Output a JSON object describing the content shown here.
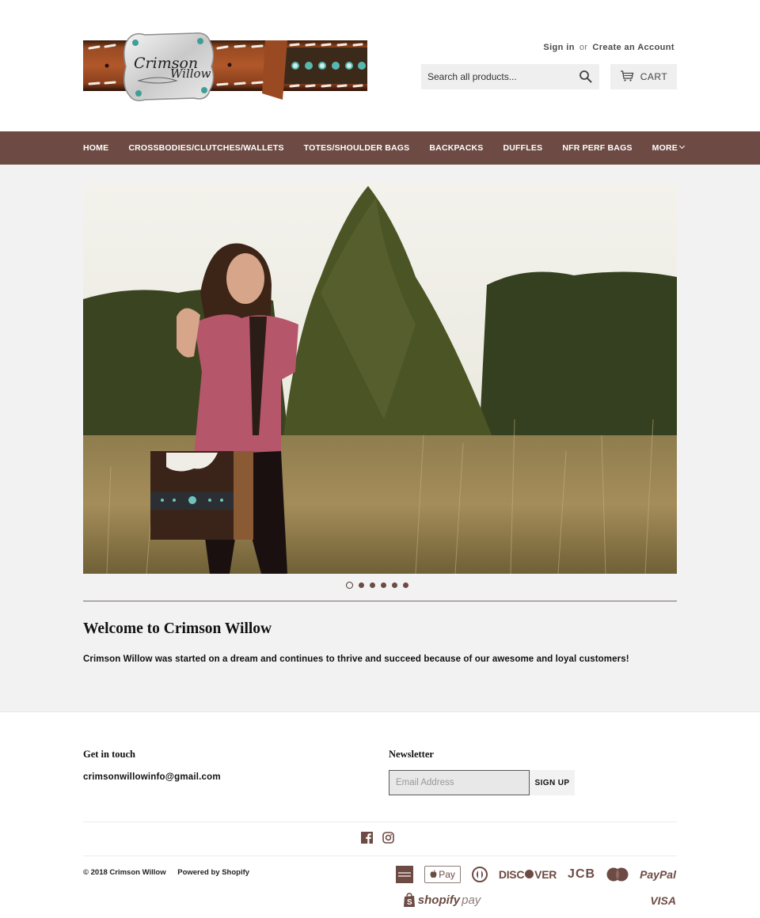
{
  "brand": {
    "name": "Crimson Willow",
    "logo_text_1": "Crimson",
    "logo_text_2": "Willow",
    "accent_color": "#6d4b44"
  },
  "header": {
    "sign_in": "Sign in",
    "or": "or",
    "create_account": "Create an Account",
    "search_placeholder": "Search all products...",
    "cart_label": "CART"
  },
  "nav": {
    "items": [
      {
        "label": "HOME"
      },
      {
        "label": "CROSSBODIES/CLUTCHES/WALLETS"
      },
      {
        "label": "TOTES/SHOULDER BAGS"
      },
      {
        "label": "BACKPACKS"
      },
      {
        "label": "DUFFLES"
      },
      {
        "label": "NFR PERF BAGS"
      },
      {
        "label": "MORE"
      }
    ]
  },
  "hero": {
    "slide_count": 6,
    "active_slide": 1,
    "image_alt": "Woman in a pink shirt carrying a cowhide tote bag in a grassy field"
  },
  "welcome": {
    "title": "Welcome to Crimson Willow",
    "text": "Crimson Willow was started on a dream and continues to thrive and succeed because of our awesome and loyal customers!"
  },
  "footer": {
    "contact_title": "Get in touch",
    "contact_email": "crimsonwillowinfo@gmail.com",
    "newsletter_title": "Newsletter",
    "newsletter_placeholder": "Email Address",
    "signup_label": "SIGN UP",
    "social": [
      "facebook-icon",
      "instagram-icon"
    ],
    "copyright": "© 2018 Crimson Willow",
    "powered_by": "Powered by Shopify",
    "payments": [
      {
        "name": "american-express",
        "label": "AMEX"
      },
      {
        "name": "apple-pay",
        "label": "Pay"
      },
      {
        "name": "diners-club",
        "label": ""
      },
      {
        "name": "discover",
        "label": "DISC",
        "label2": "VER"
      },
      {
        "name": "jcb",
        "label": "JCB"
      },
      {
        "name": "mastercard",
        "label": "MasterCard"
      },
      {
        "name": "paypal",
        "label": "PayPal"
      },
      {
        "name": "shopify-pay",
        "label": "shopify",
        "label2": "pay"
      },
      {
        "name": "visa",
        "label": "VISA"
      }
    ]
  }
}
